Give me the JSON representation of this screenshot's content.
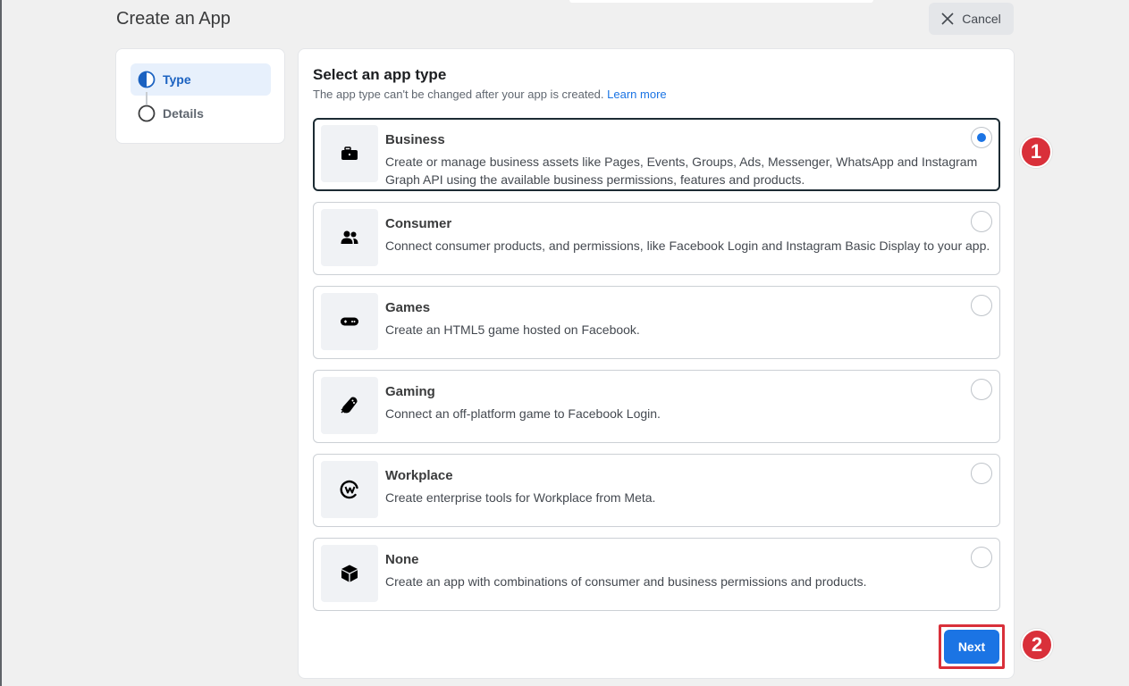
{
  "header": {
    "title": "Create an App",
    "cancel_label": "Cancel"
  },
  "steps": [
    {
      "label": "Type",
      "state": "active"
    },
    {
      "label": "Details",
      "state": "inactive"
    }
  ],
  "main": {
    "title": "Select an app type",
    "subtitle": "The app type can't be changed after your app is created.",
    "learn_more": "Learn more",
    "options": [
      {
        "title": "Business",
        "icon": "briefcase-icon",
        "selected": true,
        "description": "Create or manage business assets like Pages, Events, Groups, Ads, Messenger, WhatsApp and Instagram Graph API using the available business permissions, features and products."
      },
      {
        "title": "Consumer",
        "icon": "people-icon",
        "selected": false,
        "description": "Connect consumer products, and permissions, like Facebook Login and Instagram Basic Display to your app."
      },
      {
        "title": "Games",
        "icon": "gamepad-icon",
        "selected": false,
        "description": "Create an HTML5 game hosted on Facebook."
      },
      {
        "title": "Gaming",
        "icon": "controller-icon",
        "selected": false,
        "description": "Connect an off-platform game to Facebook Login."
      },
      {
        "title": "Workplace",
        "icon": "workplace-icon",
        "selected": false,
        "description": "Create enterprise tools for Workplace from Meta."
      },
      {
        "title": "None",
        "icon": "cube-icon",
        "selected": false,
        "description": "Create an app with combinations of consumer and business permissions and products."
      }
    ],
    "next_label": "Next"
  },
  "annotations": [
    {
      "label": "1"
    },
    {
      "label": "2"
    }
  ],
  "colors": {
    "accent": "#1b74e4",
    "annotation": "#d9303a",
    "selected_border": "#1c2b33"
  }
}
